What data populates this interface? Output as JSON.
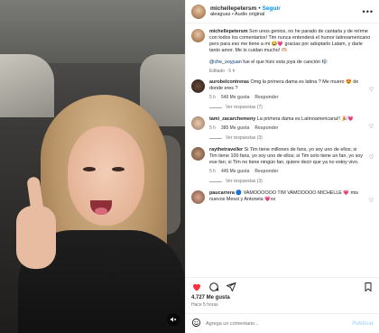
{
  "header": {
    "username": "michellepetersm",
    "follow_label": "Seguir",
    "audio": "aleaguas • Audio original"
  },
  "caption": {
    "username": "michellepetersm",
    "text": "Son unos genios, no he parado de cantarla y de reírme con todos los comentarios! Tim nunca entenderá el humor latinoamericano pero para eso me tiene a mi 😂💗 gracias por adoptarlo Latam, y darle tanto amor. Me lo cuidan mucho! 🫶🏼",
    "mention": "@che_soyjuan",
    "mention_text": "fue el que hizo esta joya de canción 🎼",
    "meta": "Editado · 5 h"
  },
  "comments": [
    {
      "username": "aurobelcontreras",
      "text": "Omg la primera dama es latina ? Me muero 😍 de donde eres ?",
      "time": "5 h",
      "likes": "540 Me gusta",
      "reply": "Responder",
      "view_replies": "Ver respuestas (7)"
    },
    {
      "username": "tami_zacarchemeny",
      "text": "La primera dama es Latinoamericana!! 🎉💗",
      "time": "5 h",
      "likes": "385 Me gusta",
      "reply": "Responder",
      "view_replies": "Ver respuestas (3)"
    },
    {
      "username": "raythetraveller",
      "text": "Si Tim tiene millones de fans, yo soy uno de ellos; si Tim tiene 100 fans, yo soy uno de ellos; si Tim solo tiene un fan, yo soy ese fan; si Tim no tiene ningún fan, quiere decir que ya no estoy vivo.",
      "time": "5 h",
      "likes": "445 Me gusta",
      "reply": "Responder",
      "view_replies": "Ver respuestas (3)"
    },
    {
      "username": "paucarrera",
      "text": "🔵 VAMOOOOOO TIM VAMOOOOO MICHELLE 💗 mis nuevos Messi y Antonela 💗xx",
      "time": "5 h",
      "likes": "",
      "reply": "",
      "view_replies": ""
    }
  ],
  "footer": {
    "likes": "4.727 Me gusta",
    "ago": "Hace 5 horas",
    "add_comment_placeholder": "Agrega un comentario...",
    "publish_label": "Publicar"
  },
  "colors": {
    "accent": "#0095f6",
    "like_red": "#ff3040",
    "muted": "#737373"
  },
  "icons": [
    "heart-icon",
    "comment-icon",
    "share-icon",
    "bookmark-icon",
    "emoji-icon",
    "more-icon",
    "sound-icon"
  ]
}
